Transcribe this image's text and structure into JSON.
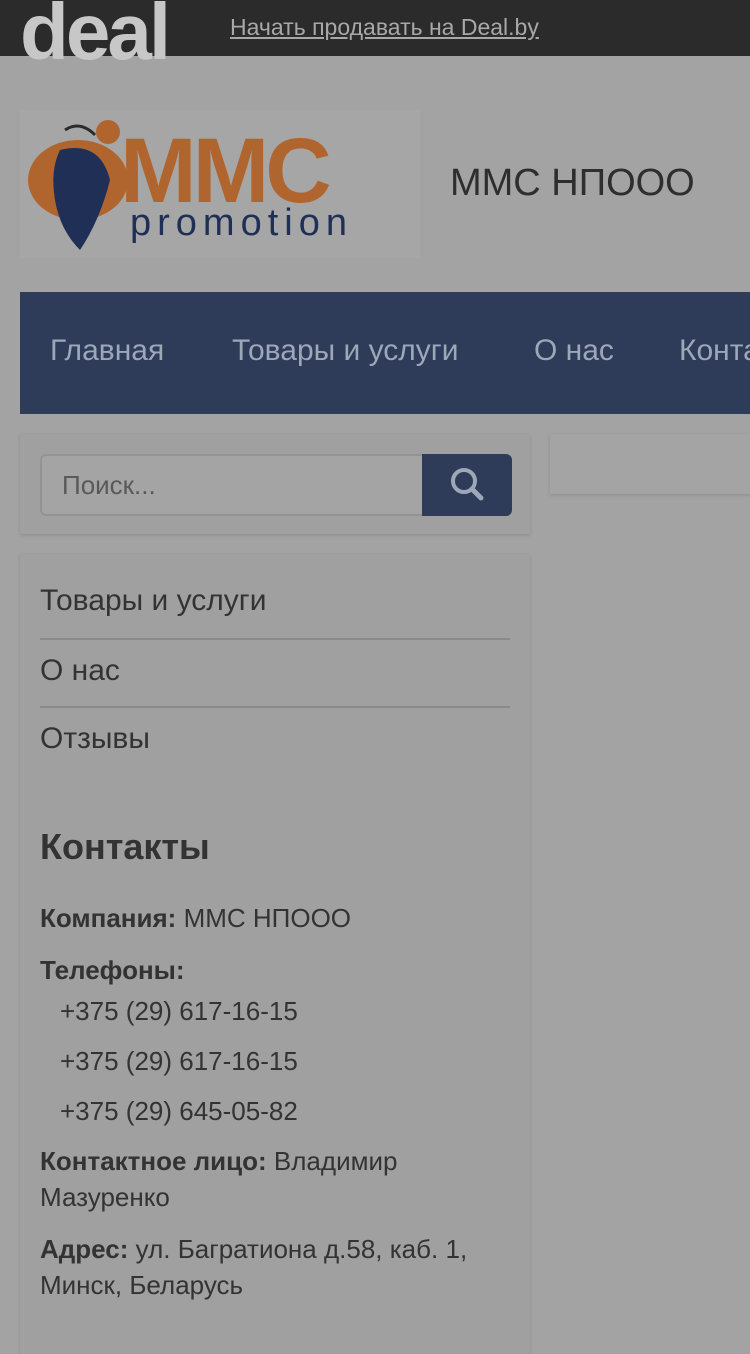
{
  "topbar": {
    "logo_text": "deal",
    "sell_link": "Начать продавать на Deal.by"
  },
  "header": {
    "logo": {
      "mark_text": "MMC",
      "sub_text": "promotion"
    },
    "company_title": "ММС НПООО"
  },
  "nav": {
    "items": [
      {
        "label": "Главная"
      },
      {
        "label": "Товары и услуги"
      },
      {
        "label": "О нас"
      },
      {
        "label": "Контакты"
      }
    ]
  },
  "search": {
    "placeholder": "Поиск..."
  },
  "sidebar": {
    "menu": [
      {
        "label": "Товары и услуги"
      },
      {
        "label": "О нас"
      },
      {
        "label": "Отзывы"
      }
    ]
  },
  "contacts": {
    "title": "Контакты",
    "company_label": "Компания:",
    "company_value": "ММС НПООО",
    "phones_label": "Телефоны:",
    "phones": [
      "+375 (29) 617-16-15",
      "+375 (29) 617-16-15",
      "+375 (29) 645-05-82"
    ],
    "person_label": "Контактное лицо:",
    "person_value": "Владимир Мазуренко",
    "address_label": "Адрес:",
    "address_value": "ул. Багратиона д.58, каб. 1, Минск, Беларусь"
  },
  "colors": {
    "nav_bg": "#2e3c59",
    "logo_orange": "#b0652e",
    "logo_blue": "#1f2f55"
  },
  "icons": {
    "search": "search-icon"
  }
}
